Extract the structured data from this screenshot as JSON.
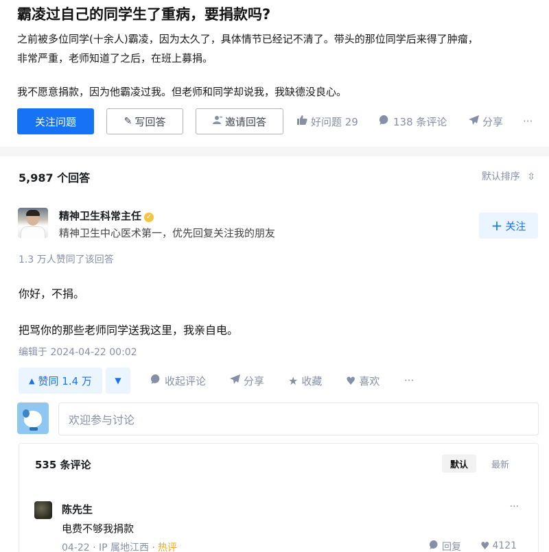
{
  "question": {
    "title": "霸凌过自己的同学生了重病，要捐款吗?",
    "body": [
      "之前被多位同学(十余人)霸凌，因为太久了，具体情节已经记不清了。带头的那位同学后来得了肿瘤，",
      "非常严重，老师知道了之后，在班上募捐。",
      "我不愿意捐款，因为他霸凌过我。但老师和同学却说我，我缺德没良心。"
    ],
    "actions": {
      "follow_label": "关注问题",
      "write_answer_label": "写回答",
      "invite_label": "邀请回答",
      "good_question_label": "好问题 29",
      "comments_label": "138 条评论",
      "share_label": "分享",
      "more_label": "···"
    },
    "accent_color": "#1772f6"
  },
  "answers": {
    "count_label": "5,987 个回答",
    "sort_label": "默认排序"
  },
  "answer": {
    "author": {
      "name": "精神卫生科常主任",
      "description": "精神卫生中心医术第一，优先回复关注我的朋友",
      "follow_label": "关注"
    },
    "upvoted_label": "1.3 万人赞同了该回答",
    "content": [
      "你好，不捐。",
      "把骂你的那些老师同学送我这里，我亲自电。"
    ],
    "edited_label": "编辑于 2024-04-22 00:02",
    "actions": {
      "upvote_label": "赞同 1.4 万",
      "collapse_comments_label": "收起评论",
      "share_label": "分享",
      "collect_label": "收藏",
      "like_label": "喜欢",
      "more_label": "···"
    }
  },
  "comment_input": {
    "placeholder": "欢迎参与讨论"
  },
  "comments": {
    "count_label": "535 条评论",
    "sort_default": "默认",
    "sort_latest": "最新",
    "items": [
      {
        "author": "陈先生",
        "text": "电费不够我捐款",
        "meta": "04-22 · IP 属地江西 ·",
        "tag": "热评",
        "reply_label": "回复",
        "likes": "4121"
      }
    ]
  }
}
